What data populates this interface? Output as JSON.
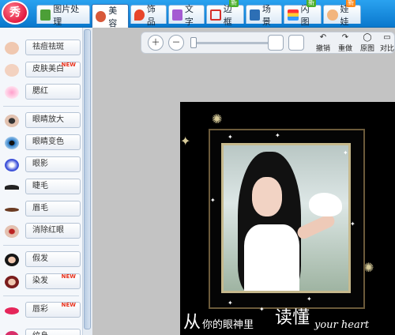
{
  "app": {
    "logo_text": "秀"
  },
  "tabs": [
    {
      "label": "图片处理",
      "badge": ""
    },
    {
      "label": "美容",
      "badge": ""
    },
    {
      "label": "饰品",
      "badge": ""
    },
    {
      "label": "文字",
      "badge": ""
    },
    {
      "label": "边框",
      "badge": "新"
    },
    {
      "label": "场景",
      "badge": ""
    },
    {
      "label": "闪图",
      "badge": "新"
    },
    {
      "label": "娃娃",
      "badge": "新"
    }
  ],
  "sidebar": {
    "items": [
      {
        "label": "祛痘祛斑",
        "new": ""
      },
      {
        "label": "皮肤美白",
        "new": "NEW"
      },
      {
        "label": "腮红",
        "new": ""
      },
      {
        "label": "眼睛放大",
        "new": ""
      },
      {
        "label": "眼睛变色",
        "new": ""
      },
      {
        "label": "眼影",
        "new": ""
      },
      {
        "label": "睫毛",
        "new": ""
      },
      {
        "label": "眉毛",
        "new": ""
      },
      {
        "label": "消除红眼",
        "new": ""
      },
      {
        "label": "假发",
        "new": ""
      },
      {
        "label": "染发",
        "new": "NEW"
      },
      {
        "label": "唇彩",
        "new": "NEW"
      },
      {
        "label": "纹身",
        "new": ""
      }
    ]
  },
  "toolbar": {
    "undo": "撤销",
    "redo": "重做",
    "original": "原图",
    "compare": "对比"
  },
  "photo": {
    "caption_big1": "从",
    "caption_small": "你的眼神里",
    "caption_big2": "读懂",
    "caption_en": "your heart"
  }
}
